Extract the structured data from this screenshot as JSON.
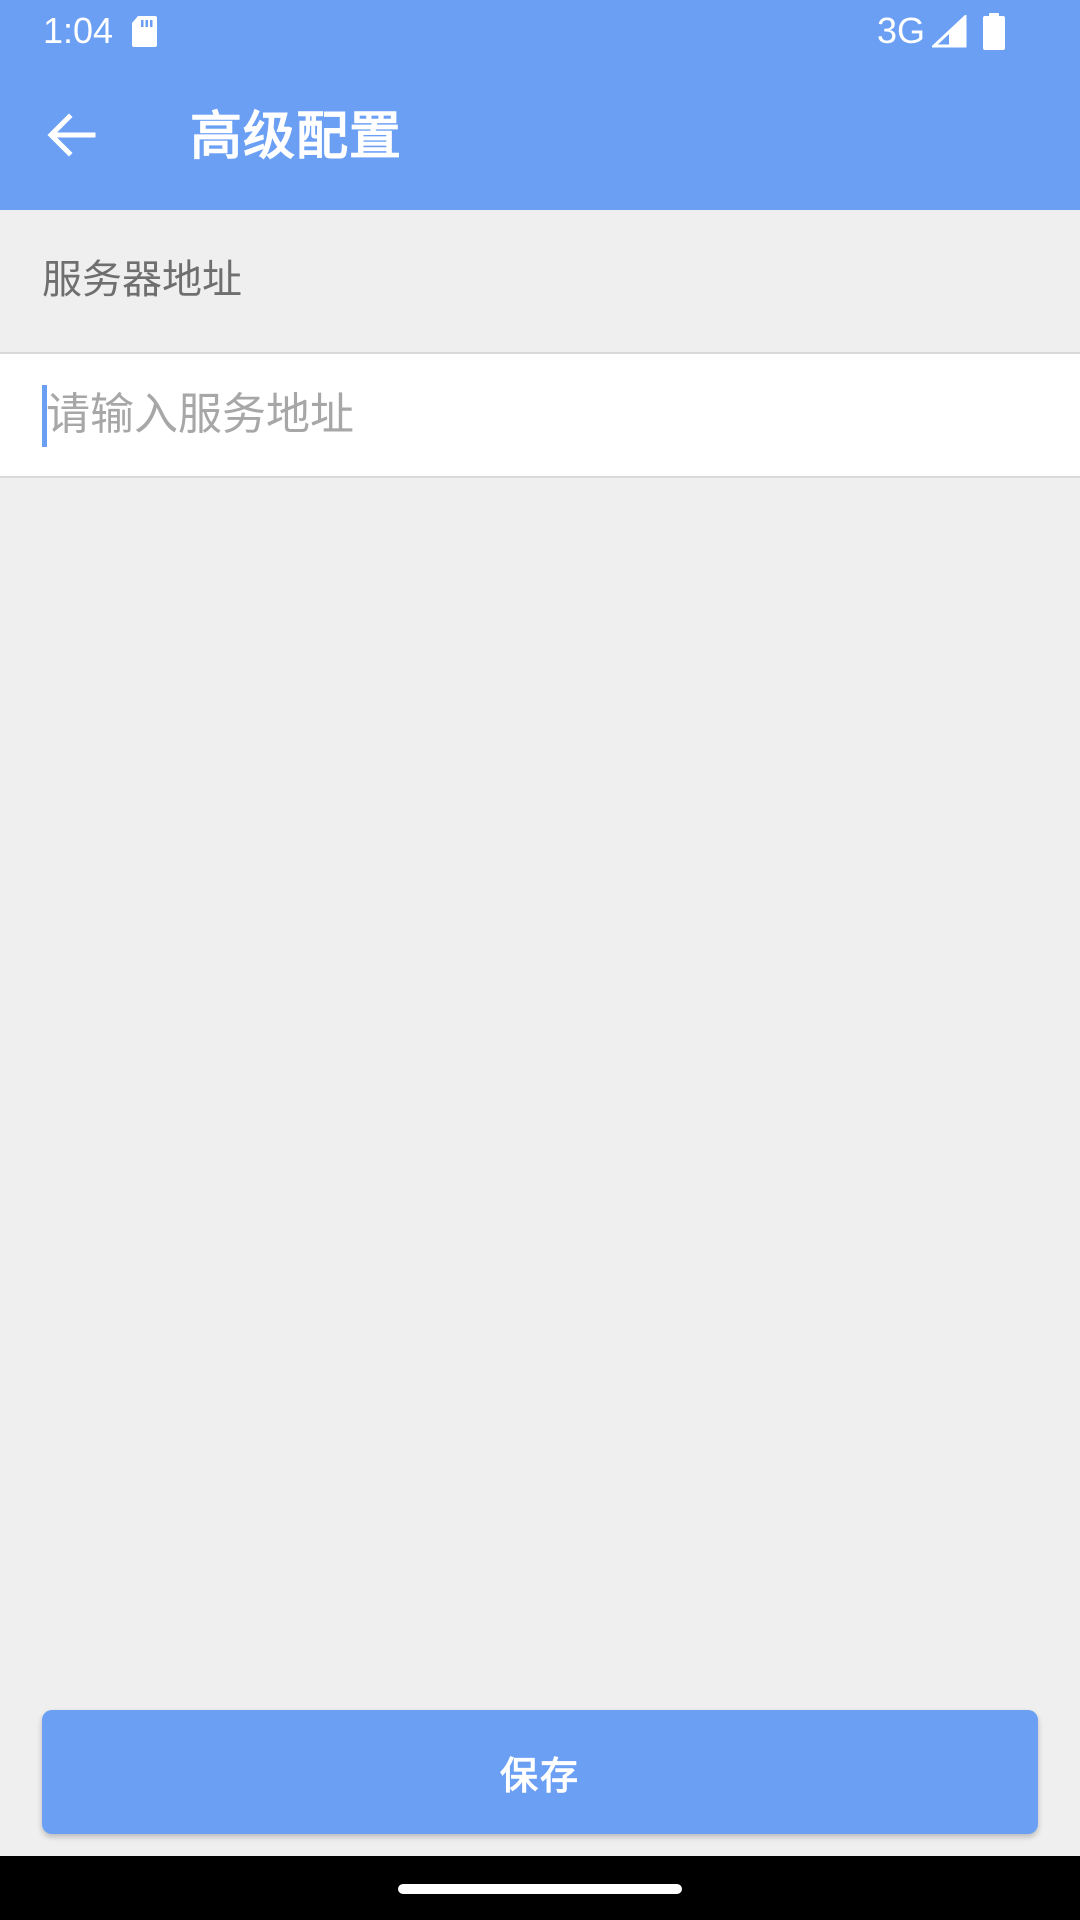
{
  "status_bar": {
    "time": "1:04",
    "network": "3G",
    "icons": [
      "sd-card-icon",
      "signal-icon",
      "battery-icon"
    ]
  },
  "toolbar": {
    "title": "高级配置",
    "back_icon": "arrow-left-icon"
  },
  "form": {
    "section_label": "服务器地址",
    "server_input": {
      "value": "",
      "placeholder": "请输入服务地址"
    }
  },
  "actions": {
    "save_label": "保存"
  },
  "colors": {
    "accent": "#6a9ff4",
    "background": "#efefef",
    "surface": "#ffffff",
    "label_text": "#6f6f6f",
    "placeholder_text": "#a7a7a7",
    "nav_bar": "#000000"
  }
}
